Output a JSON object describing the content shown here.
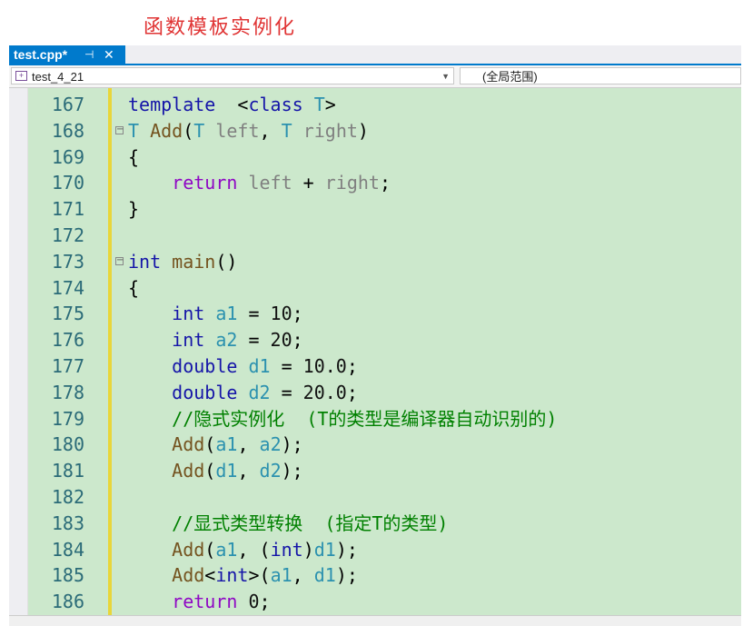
{
  "page_title": "函数模板实例化",
  "tab": {
    "label": "test.cpp*",
    "pin_glyph": "⊣",
    "close_glyph": "✕"
  },
  "navbar": {
    "project": "test_4_21",
    "scope": "(全局范围)",
    "arrow_glyph": "▼"
  },
  "code": {
    "lines": [
      {
        "n": "167",
        "fold": false,
        "tokens": [
          [
            "kw",
            "template"
          ],
          [
            "",
            "  <"
          ],
          [
            "kw",
            "class"
          ],
          [
            "",
            ""
          ],
          [
            "tp",
            " T"
          ],
          [
            "",
            ">"
          ]
        ]
      },
      {
        "n": "168",
        "fold": true,
        "tokens": [
          [
            "tp",
            "T"
          ],
          [
            "",
            ""
          ],
          [
            "fn",
            " Add"
          ],
          [
            "",
            "("
          ],
          [
            "tp",
            "T"
          ],
          [
            "pm",
            " left"
          ],
          [
            "",
            ", "
          ],
          [
            "tp",
            "T"
          ],
          [
            "pm",
            " right"
          ],
          [
            "",
            ")"
          ]
        ]
      },
      {
        "n": "169",
        "fold": false,
        "tokens": [
          [
            "",
            "{"
          ]
        ]
      },
      {
        "n": "170",
        "fold": false,
        "tokens": [
          [
            "",
            "    "
          ],
          [
            "rt",
            "return"
          ],
          [
            "pm",
            " left"
          ],
          [
            "",
            " + "
          ],
          [
            "pm",
            "right"
          ],
          [
            "",
            ";"
          ]
        ]
      },
      {
        "n": "171",
        "fold": false,
        "tokens": [
          [
            "",
            "}"
          ]
        ]
      },
      {
        "n": "172",
        "fold": false,
        "tokens": []
      },
      {
        "n": "173",
        "fold": true,
        "tokens": [
          [
            "kw",
            "int"
          ],
          [
            "fn",
            " main"
          ],
          [
            "",
            "()"
          ]
        ]
      },
      {
        "n": "174",
        "fold": false,
        "tokens": [
          [
            "",
            "{"
          ]
        ]
      },
      {
        "n": "175",
        "fold": false,
        "tokens": [
          [
            "",
            "    "
          ],
          [
            "kw",
            "int"
          ],
          [
            "tp",
            " a1"
          ],
          [
            "",
            " = "
          ],
          [
            "nm",
            "10"
          ],
          [
            "",
            ";"
          ]
        ]
      },
      {
        "n": "176",
        "fold": false,
        "tokens": [
          [
            "",
            "    "
          ],
          [
            "kw",
            "int"
          ],
          [
            "tp",
            " a2"
          ],
          [
            "",
            " = "
          ],
          [
            "nm",
            "20"
          ],
          [
            "",
            ";"
          ]
        ]
      },
      {
        "n": "177",
        "fold": false,
        "tokens": [
          [
            "",
            "    "
          ],
          [
            "kw",
            "double"
          ],
          [
            "tp",
            " d1"
          ],
          [
            "",
            " = "
          ],
          [
            "nm",
            "10.0"
          ],
          [
            "",
            ";"
          ]
        ]
      },
      {
        "n": "178",
        "fold": false,
        "tokens": [
          [
            "",
            "    "
          ],
          [
            "kw",
            "double"
          ],
          [
            "tp",
            " d2"
          ],
          [
            "",
            " = "
          ],
          [
            "nm",
            "20.0"
          ],
          [
            "",
            ";"
          ]
        ]
      },
      {
        "n": "179",
        "fold": false,
        "tokens": [
          [
            "",
            "    "
          ],
          [
            "cm",
            "//隐式实例化  (T的类型是编译器自动识别的)"
          ]
        ]
      },
      {
        "n": "180",
        "fold": false,
        "tokens": [
          [
            "",
            "    "
          ],
          [
            "fn",
            "Add"
          ],
          [
            "",
            "("
          ],
          [
            "tp",
            "a1"
          ],
          [
            "",
            ", "
          ],
          [
            "tp",
            "a2"
          ],
          [
            "",
            ");"
          ]
        ]
      },
      {
        "n": "181",
        "fold": false,
        "tokens": [
          [
            "",
            "    "
          ],
          [
            "fn",
            "Add"
          ],
          [
            "",
            "("
          ],
          [
            "tp",
            "d1"
          ],
          [
            "",
            ", "
          ],
          [
            "tp",
            "d2"
          ],
          [
            "",
            ");"
          ]
        ]
      },
      {
        "n": "182",
        "fold": false,
        "tokens": []
      },
      {
        "n": "183",
        "fold": false,
        "tokens": [
          [
            "",
            "    "
          ],
          [
            "cm",
            "//显式类型转换  (指定T的类型)"
          ]
        ]
      },
      {
        "n": "184",
        "fold": false,
        "tokens": [
          [
            "",
            "    "
          ],
          [
            "fn",
            "Add"
          ],
          [
            "",
            "("
          ],
          [
            "tp",
            "a1"
          ],
          [
            "",
            ", ("
          ],
          [
            "kw",
            "int"
          ],
          [
            "",
            ")"
          ],
          [
            "tp",
            "d1"
          ],
          [
            "",
            ");"
          ]
        ]
      },
      {
        "n": "185",
        "fold": false,
        "tokens": [
          [
            "",
            "    "
          ],
          [
            "fn",
            "Add"
          ],
          [
            "",
            "<"
          ],
          [
            "kw",
            "int"
          ],
          [
            "",
            ">("
          ],
          [
            "tp",
            "a1"
          ],
          [
            "",
            ", "
          ],
          [
            "tp",
            "d1"
          ],
          [
            "",
            ");"
          ]
        ]
      },
      {
        "n": "186",
        "fold": false,
        "tokens": [
          [
            "",
            "    "
          ],
          [
            "rt",
            "return"
          ],
          [
            "nm",
            " 0"
          ],
          [
            "",
            ";"
          ]
        ]
      }
    ]
  }
}
